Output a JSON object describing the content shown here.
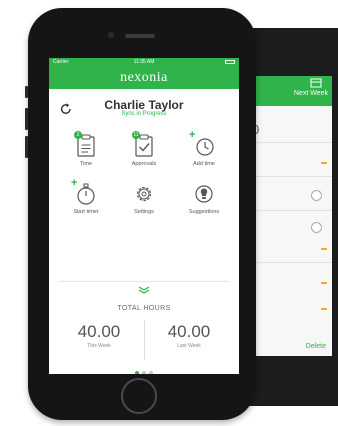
{
  "back_screen": {
    "next_label": "Next Week",
    "value": "0",
    "delete_label": "Delete"
  },
  "status_bar": {
    "carrier": "Carrier",
    "time": "11:35 AM"
  },
  "app": {
    "logo": "nexonia",
    "user_name": "Charlie Taylor",
    "sync_status": "Sync in Progress"
  },
  "tiles": [
    {
      "label": "Time",
      "icon": "clipboard-icon",
      "badge": "2"
    },
    {
      "label": "Approvals",
      "icon": "approval-checklist-icon",
      "badge": "11"
    },
    {
      "label": "Add time",
      "icon": "add-time-clock-icon"
    },
    {
      "label": "Start timer",
      "icon": "stopwatch-icon"
    },
    {
      "label": "Settings",
      "icon": "gear-icon"
    },
    {
      "label": "Suggestions",
      "icon": "lightbulb-icon"
    }
  ],
  "totals": {
    "title": "TOTAL HOURS",
    "this_week_value": "40.00",
    "this_week_label": "This Week",
    "last_week_value": "40.00",
    "last_week_label": "Last Week"
  },
  "pager": {
    "current": 1,
    "count": 3
  },
  "colors": {
    "accent": "#2fb34a",
    "phone_body": "#151517"
  }
}
